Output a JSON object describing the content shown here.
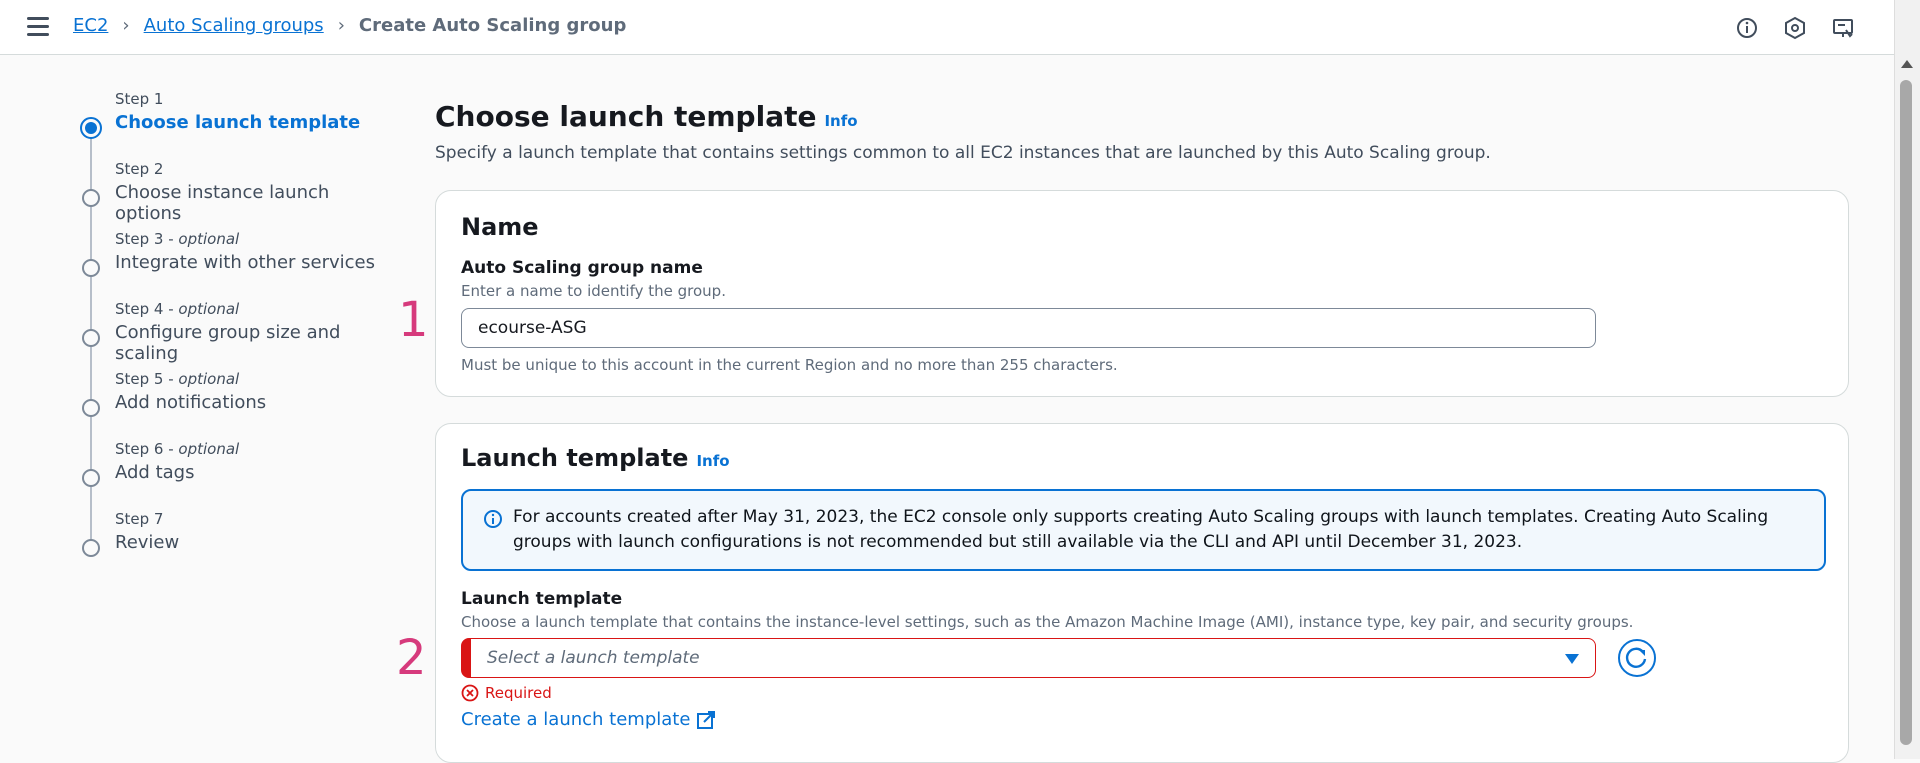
{
  "breadcrumb": {
    "items": [
      "EC2",
      "Auto Scaling groups"
    ],
    "current": "Create Auto Scaling group"
  },
  "top_icons": [
    "info-circle-icon",
    "settings-hex-icon",
    "feedback-icon"
  ],
  "steps": [
    {
      "num": "Step 1",
      "optional": "",
      "title": "Choose launch template",
      "active": true
    },
    {
      "num": "Step 2",
      "optional": "",
      "title": "Choose instance launch options"
    },
    {
      "num": "Step 3",
      "optional": "optional",
      "title": "Integrate with other services"
    },
    {
      "num": "Step 4",
      "optional": "optional",
      "title": "Configure group size and scaling"
    },
    {
      "num": "Step 5",
      "optional": "optional",
      "title": "Add notifications"
    },
    {
      "num": "Step 6",
      "optional": "optional",
      "title": "Add tags"
    },
    {
      "num": "Step 7",
      "optional": "",
      "title": "Review"
    }
  ],
  "page": {
    "title": "Choose launch template",
    "info": "Info",
    "description": "Specify a launch template that contains settings common to all EC2 instances that are launched by this Auto Scaling group."
  },
  "name_card": {
    "heading": "Name",
    "label": "Auto Scaling group name",
    "desc": "Enter a name to identify the group.",
    "value": "ecourse-ASG",
    "hint": "Must be unique to this account in the current Region and no more than 255 characters."
  },
  "lt_card": {
    "heading": "Launch template",
    "info": "Info",
    "alert": "For accounts created after May 31, 2023, the EC2 console only supports creating Auto Scaling groups with launch templates. Creating Auto Scaling groups with launch configurations is not recommended but still available via the CLI and API until December 31, 2023.",
    "label": "Launch template",
    "desc": "Choose a launch template that contains the instance-level settings, such as the Amazon Machine Image (AMI), instance type, key pair, and security groups.",
    "placeholder": "Select a launch template",
    "error": "Required",
    "create_link": "Create a launch template"
  },
  "annotations": [
    "1",
    "2"
  ],
  "colors": {
    "accent": "#0972d3",
    "error": "#d91515",
    "annotation": "#d63a7c"
  }
}
